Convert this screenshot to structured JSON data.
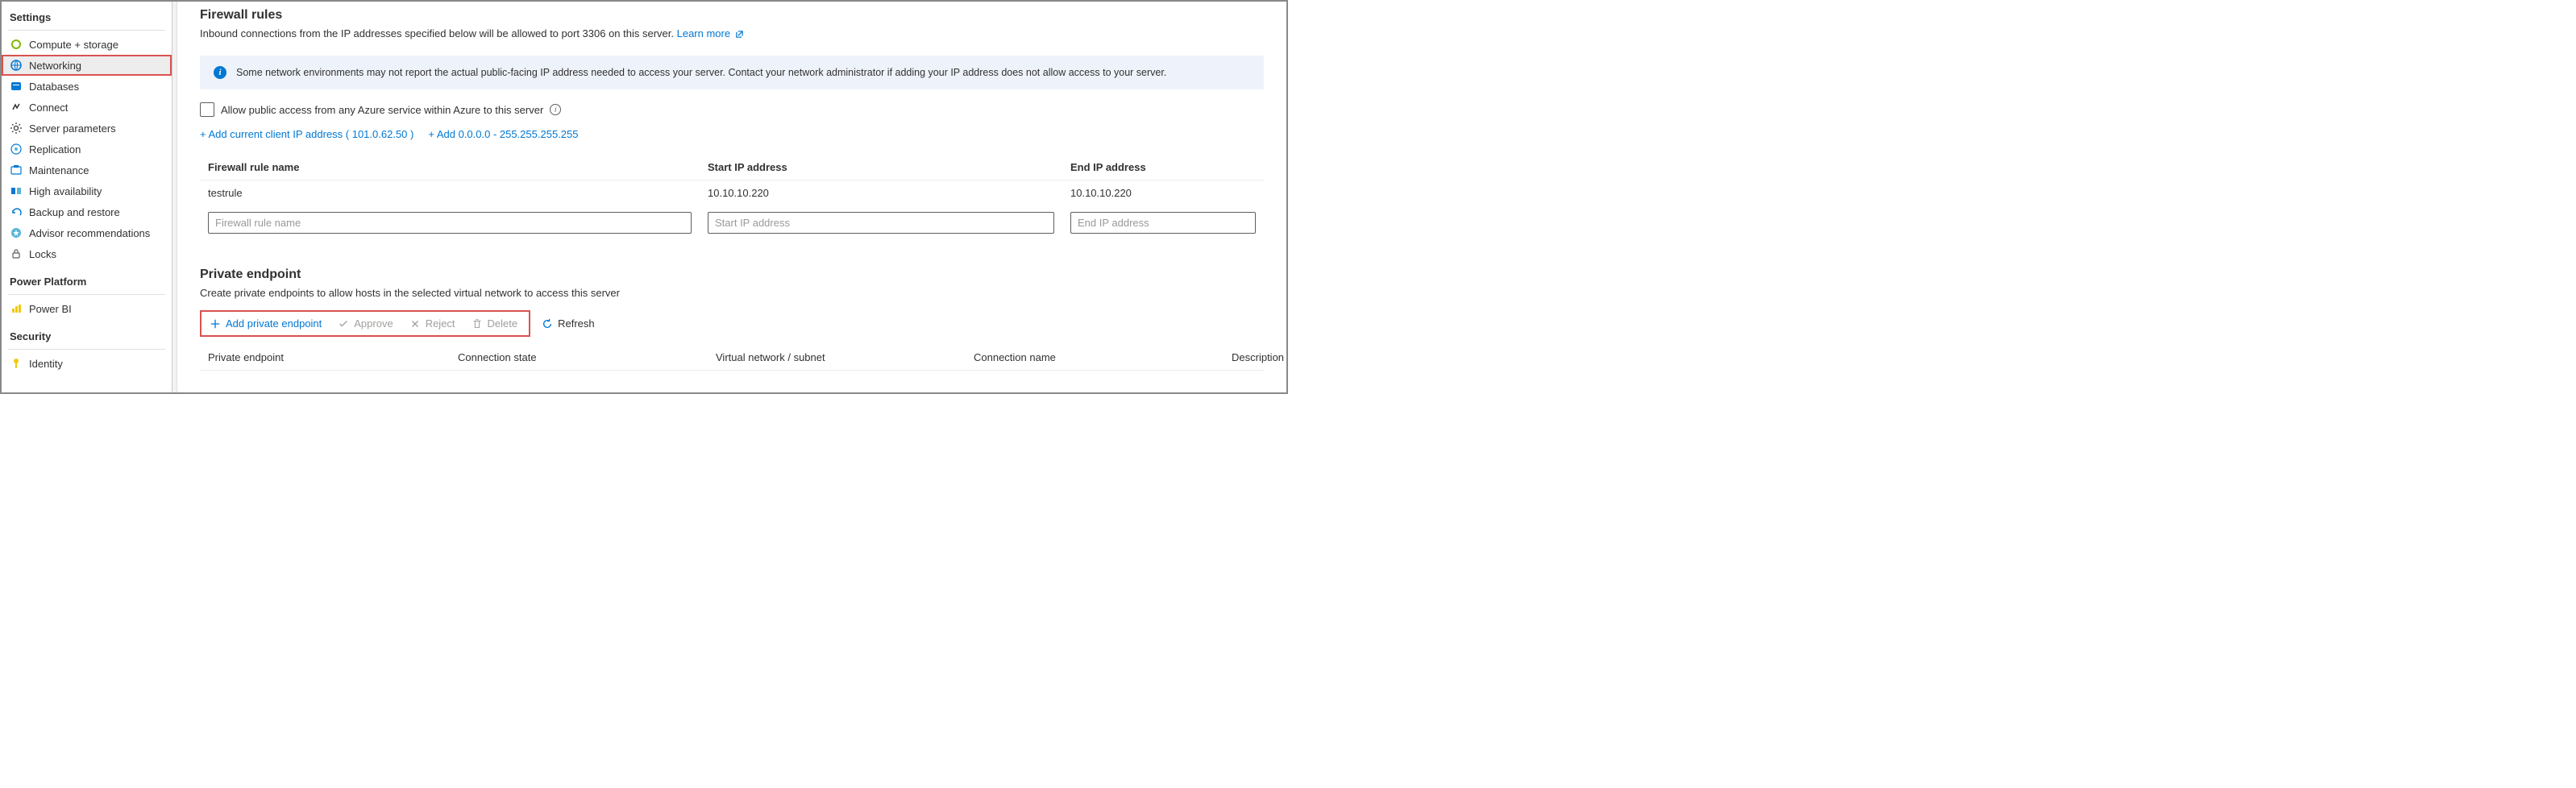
{
  "sidebar": {
    "sections": [
      {
        "header": "Settings",
        "divider": true,
        "items": [
          {
            "label": "Compute + storage",
            "iconColor": "#7fba00",
            "selected": false
          },
          {
            "label": "Networking",
            "iconColor": "#0078d4",
            "selected": true
          },
          {
            "label": "Databases",
            "iconColor": "#0078d4",
            "selected": false
          },
          {
            "label": "Connect",
            "iconColor": "#323130",
            "selected": false
          },
          {
            "label": "Server parameters",
            "iconColor": "#323130",
            "selected": false
          },
          {
            "label": "Replication",
            "iconColor": "#0078d4",
            "selected": false
          },
          {
            "label": "Maintenance",
            "iconColor": "#0078d4",
            "selected": false
          },
          {
            "label": "High availability",
            "iconColor": "#0078d4",
            "selected": false
          },
          {
            "label": "Backup and restore",
            "iconColor": "#0078d4",
            "selected": false
          },
          {
            "label": "Advisor recommendations",
            "iconColor": "#0078d4",
            "selected": false
          },
          {
            "label": "Locks",
            "iconColor": "#605e5c",
            "selected": false
          }
        ]
      },
      {
        "header": "Power Platform",
        "divider": true,
        "items": [
          {
            "label": "Power BI",
            "iconColor": "#f2c811",
            "selected": false
          }
        ]
      },
      {
        "header": "Security",
        "divider": true,
        "items": [
          {
            "label": "Identity",
            "iconColor": "#f2c811",
            "selected": false
          }
        ]
      }
    ]
  },
  "firewall": {
    "title": "Firewall rules",
    "desc_prefix": "Inbound connections from the IP addresses specified below will be allowed to port 3306 on this server. ",
    "learn_more": "Learn more",
    "info_text": "Some network environments may not report the actual public-facing IP address needed to access your server.  Contact your network administrator if adding your IP address does not allow access to your server.",
    "allow_azure_label": "Allow public access from any Azure service within Azure to this server",
    "add_current_ip": "+ Add current client IP address ( 101.0.62.50 )",
    "add_range": "+ Add 0.0.0.0 - 255.255.255.255",
    "columns": {
      "name": "Firewall rule name",
      "start": "Start IP address",
      "end": "End IP address"
    },
    "rules": [
      {
        "name": "testrule",
        "start": "10.10.10.220",
        "end": "10.10.10.220"
      }
    ],
    "placeholders": {
      "name": "Firewall rule name",
      "start": "Start IP address",
      "end": "End IP address"
    }
  },
  "private_endpoint": {
    "title": "Private endpoint",
    "desc": "Create private endpoints to allow hosts in the selected virtual network to access this server",
    "toolbar": {
      "add": "Add private endpoint",
      "approve": "Approve",
      "reject": "Reject",
      "delete": "Delete",
      "refresh": "Refresh"
    },
    "columns": {
      "endpoint": "Private endpoint",
      "state": "Connection state",
      "vnet": "Virtual network / subnet",
      "connection": "Connection name",
      "description": "Description"
    }
  }
}
